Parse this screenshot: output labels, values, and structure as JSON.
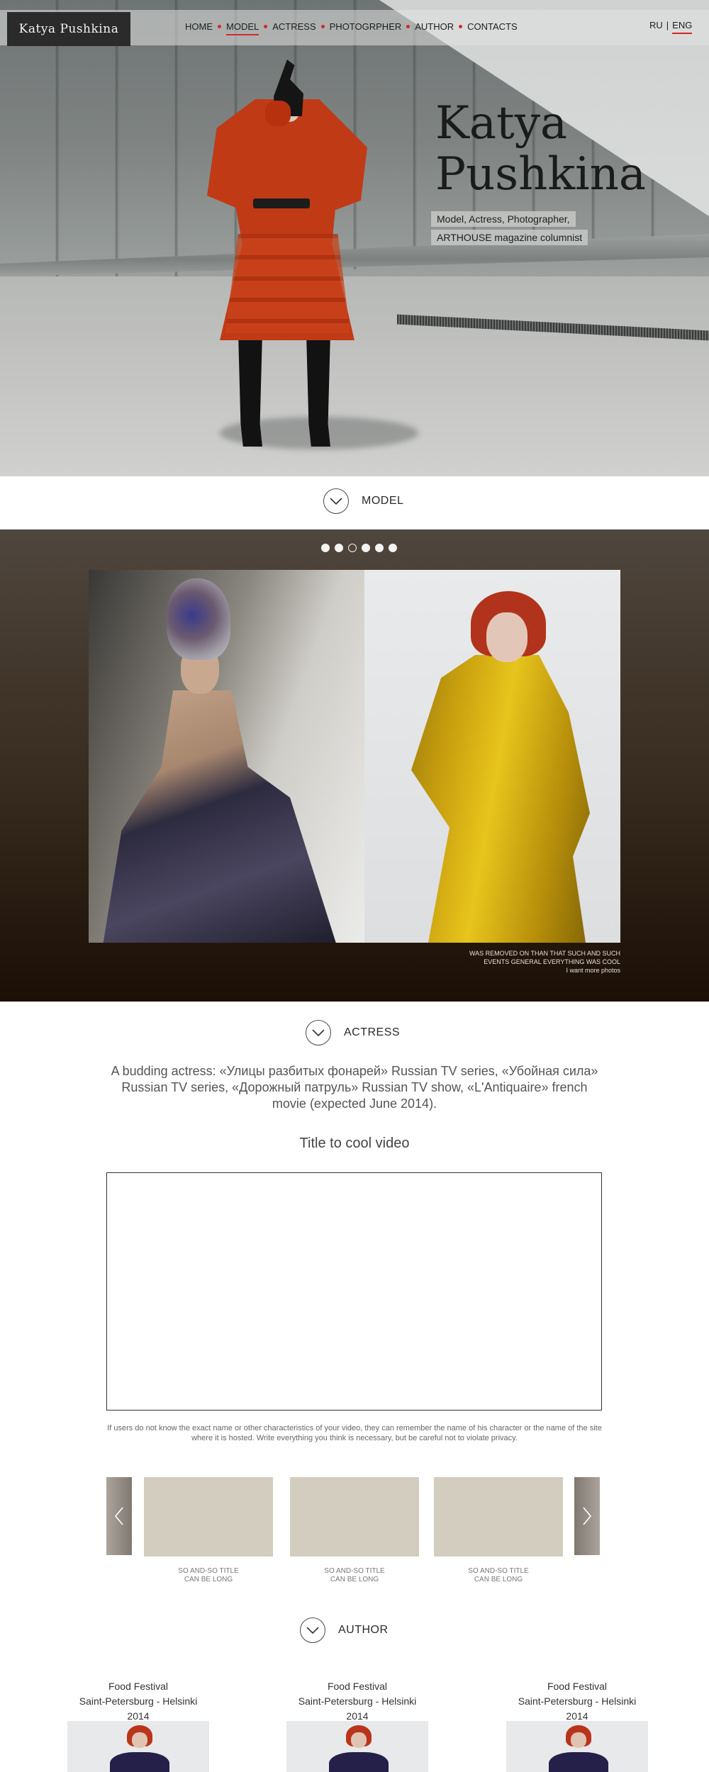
{
  "site": {
    "logo": "Katya  Pushkina",
    "accent_color": "#d02a2a"
  },
  "nav": {
    "items": [
      {
        "label": "HOME",
        "active": false
      },
      {
        "label": "MODEL",
        "active": true
      },
      {
        "label": "ACTRESS",
        "active": false
      },
      {
        "label": "PHOTOGRPHER",
        "active": false
      },
      {
        "label": "AUTHOR",
        "active": false
      },
      {
        "label": "CONTACTS",
        "active": false
      }
    ],
    "lang": {
      "ru": "RU",
      "sep": "|",
      "eng": "ENG",
      "active": "ENG"
    }
  },
  "hero": {
    "title_line1": "Katya",
    "title_line2": "Pushkina",
    "subtitle_line1": "Model, Actress, Photographer,",
    "subtitle_line2": "ARTHOUSE magazine columnist"
  },
  "sections": {
    "model": "MODEL",
    "actress": "ACTRESS",
    "author": "AUTHOR"
  },
  "gallery": {
    "slides_total": 6,
    "active_slide": 3,
    "caption_line1": "WAS REMOVED ON THAN THAT SUCH AND SUCH",
    "caption_line2": "EVENTS GENERAL EVERYTHING WAS COOL",
    "caption_link": "I want more photos"
  },
  "actress": {
    "description": "A budding actress: «Улицы разбитых фонарей» Russian TV series, «Убойная сила» Russian TV series, «Дорожный патруль» Russian TV show, «L'Antiquaire» french movie (expected June 2014).",
    "video_title": "Title to cool video",
    "video_note": "If users do not know the exact name or other characteristics of your video, they can remember the name of his character or the name of the site where it is hosted. Write everything you think is necessary, but be careful not to violate privacy.",
    "thumbs": [
      {
        "title_line1": "SO AND-SO TITLE",
        "title_line2": "CAN BE LONG"
      },
      {
        "title_line1": "SO AND-SO TITLE",
        "title_line2": "CAN BE LONG"
      },
      {
        "title_line1": "SO AND-SO TITLE",
        "title_line2": "CAN BE LONG"
      }
    ],
    "arrow_prev": "‹",
    "arrow_next": "›"
  },
  "author": {
    "events": [
      {
        "title": "Food Festival",
        "subtitle": "Saint-Petersburg - Helsinki 2014"
      },
      {
        "title": "Food Festival",
        "subtitle": "Saint-Petersburg - Helsinki 2014"
      },
      {
        "title": "Food Festival",
        "subtitle": "Saint-Petersburg - Helsinki 2014"
      }
    ]
  }
}
